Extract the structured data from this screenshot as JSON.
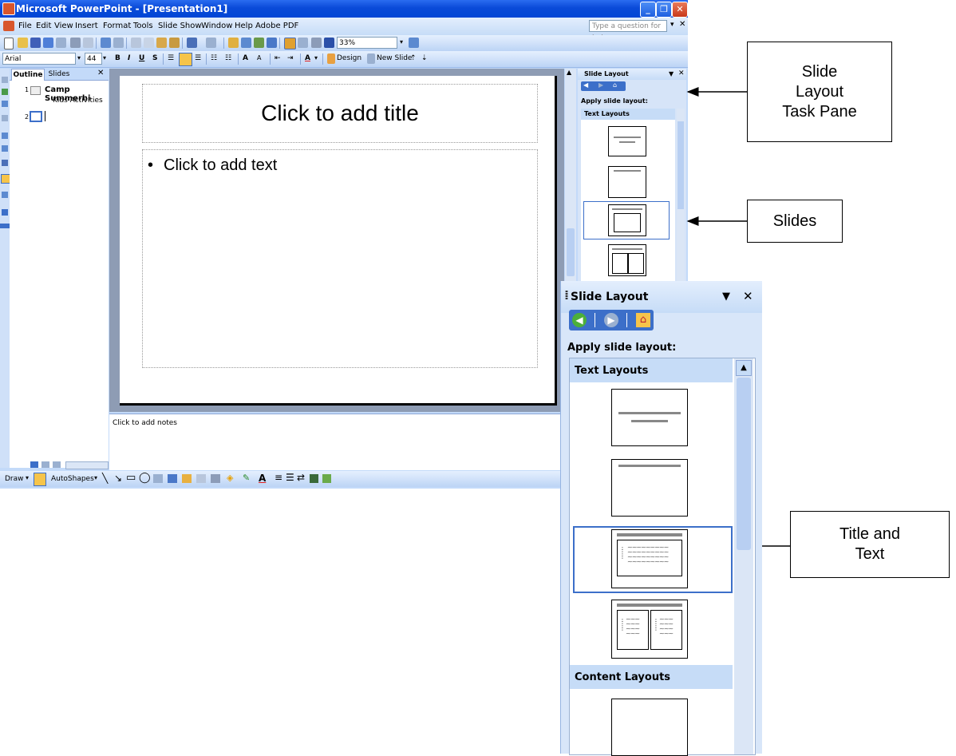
{
  "window": {
    "title": "Microsoft PowerPoint - [Presentation1]",
    "help_placeholder": "Type a question for help",
    "menu": [
      "File",
      "Edit",
      "View",
      "Insert",
      "Format",
      "Tools",
      "Slide Show",
      "Window",
      "Help",
      "Adobe PDF"
    ],
    "zoom": "33%",
    "font_name": "Arial",
    "font_size": "44",
    "design_label": "Design",
    "new_slide_label": "New Slide",
    "draw_label": "Draw",
    "autoshapes_label": "AutoShapes"
  },
  "outline_pane": {
    "tabs": [
      "Outline",
      "Slides"
    ],
    "items": [
      {
        "number": "1",
        "title": "Camp Summerhi",
        "subtitle": "Kids Activities"
      },
      {
        "number": "2"
      }
    ]
  },
  "slide": {
    "title_placeholder": "Click to add title",
    "text_placeholder": "Click to add text",
    "bullet": "•"
  },
  "notes": {
    "placeholder": "Click to add notes"
  },
  "task_pane_small": {
    "title": "Slide Layout",
    "apply_label": "Apply slide layout:",
    "section": "Text Layouts"
  },
  "task_pane_large": {
    "title": "Slide Layout",
    "apply_label": "Apply slide layout:",
    "section_text": "Text Layouts",
    "section_content": "Content Layouts"
  },
  "annotations": {
    "task_pane": [
      "Slide",
      "Layout",
      "Task Pane"
    ],
    "slides": "Slides",
    "title_text": [
      "Title and",
      "Text"
    ]
  },
  "colors": {
    "titlebar": "#0a4ad8",
    "toolbar": "#c6dcf7",
    "selection": "#3c6fc9",
    "slide_bg": "#8e9cb4"
  }
}
